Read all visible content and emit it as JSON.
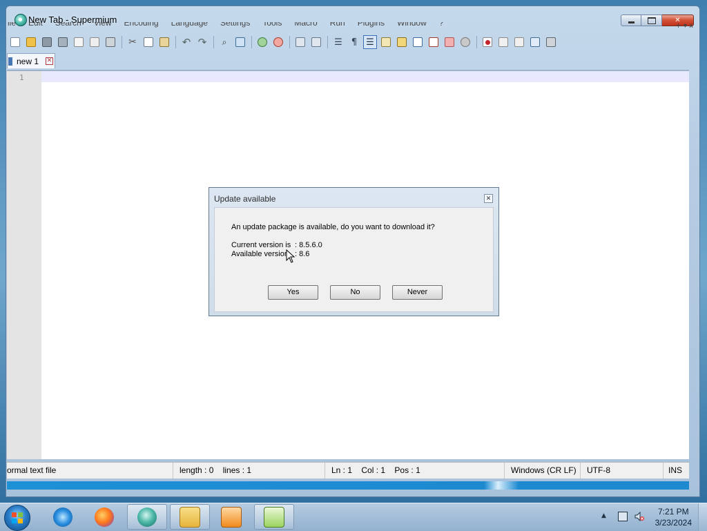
{
  "window": {
    "title": "New Tab - Supermium"
  },
  "menu": {
    "items": [
      "ile",
      "Edit",
      "Search",
      "View",
      "Encoding",
      "Language",
      "Settings",
      "Tools",
      "Macro",
      "Run",
      "Plugins",
      "Window",
      "?"
    ],
    "right_glyphs": "+ ▾ x"
  },
  "tabs": [
    {
      "label": "new 1",
      "active": true
    }
  ],
  "editor": {
    "line_numbers": [
      "1"
    ],
    "content": ""
  },
  "status": {
    "file_type": "ormal text file",
    "length": "length : 0",
    "lines": "lines : 1",
    "ln": "Ln : 1",
    "col": "Col : 1",
    "pos": "Pos : 1",
    "eol": "Windows (CR LF)",
    "encoding": "UTF-8",
    "mode": "INS"
  },
  "dialog": {
    "title": "Update available",
    "message": "An update package is available, do you want to download it?",
    "current_label": "Current version is",
    "current_value": ": 8.5.6.0",
    "available_label": "Available version",
    "available_value": ": 8.6",
    "buttons": {
      "yes": "Yes",
      "no": "No",
      "never": "Never"
    }
  },
  "taskbar": {
    "items": [
      "internet-explorer-icon",
      "firefox-icon",
      "supermium-icon",
      "file-explorer-icon",
      "media-player-icon",
      "notepad-plus-plus-icon"
    ],
    "clock_time": "7:21 PM",
    "clock_date": "3/23/2024"
  },
  "colors": {
    "accent": "#3b6fb6",
    "close_red": "#c0321c",
    "current_line": "#e8e8ff",
    "gutter": "#e4e4e4"
  }
}
